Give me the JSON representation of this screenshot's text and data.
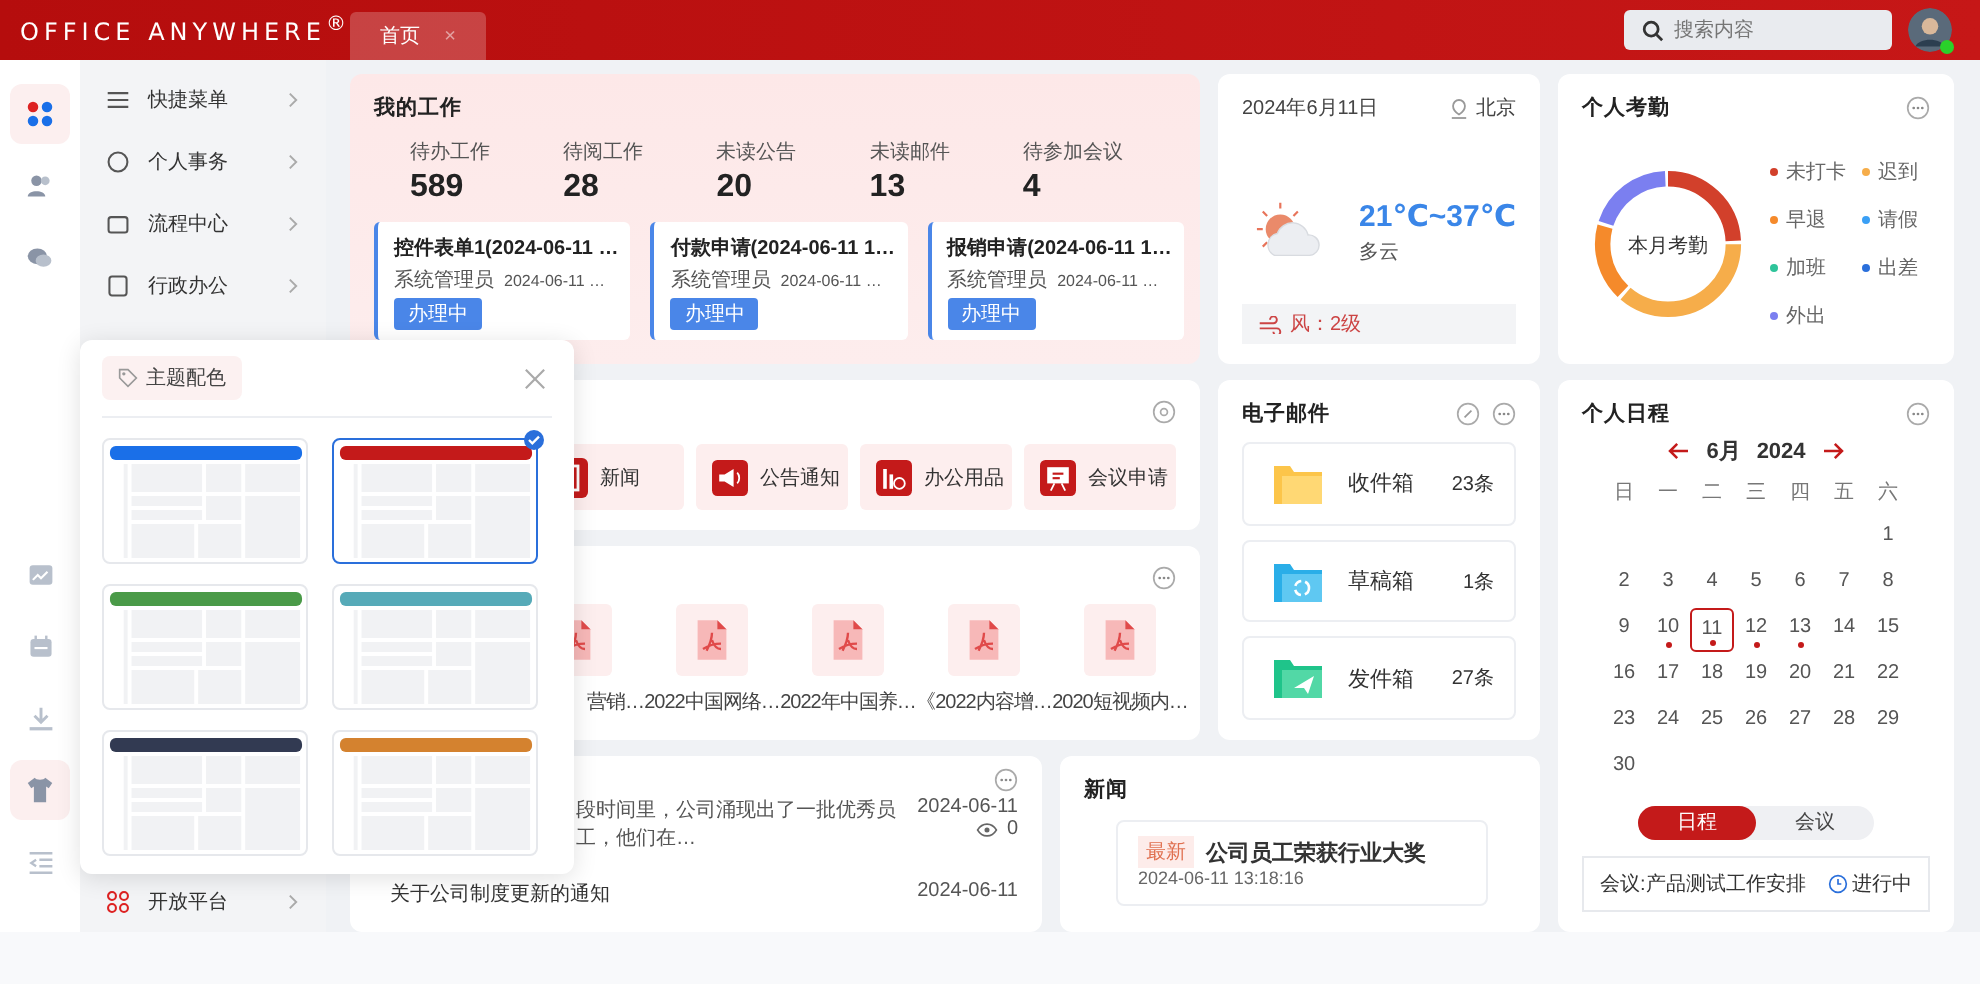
{
  "topbar": {
    "logo": "OFFICE ANYWHERE$^{®}$",
    "tabs": [
      {
        "label": "首页",
        "selected": true,
        "close": "×"
      }
    ],
    "search": {
      "placeholder": "搜索内容"
    },
    "user": {
      "online": true
    }
  },
  "rail_top": [
    {
      "kind": "apps",
      "selected": true
    },
    {
      "kind": "contacts",
      "selected": false
    },
    {
      "kind": "chat",
      "selected": false
    }
  ],
  "rail_bottom": [
    {
      "kind": "chart",
      "selected": false
    },
    {
      "kind": "calendar",
      "selected": false
    },
    {
      "kind": "download",
      "selected": false
    },
    {
      "kind": "theme",
      "selected": true
    },
    {
      "kind": "collapse",
      "selected": false
    }
  ],
  "menu": [
    {
      "label": "快捷菜单",
      "kind": "shortcut"
    },
    {
      "label": "个人事务",
      "kind": "personal"
    },
    {
      "label": "流程中心",
      "kind": "workflow"
    },
    {
      "label": "行政办公",
      "kind": "admin"
    }
  ],
  "menu_bottom": [
    {
      "label": "开放平台",
      "kind": "platform"
    }
  ],
  "theme_popup": {
    "title": "主题配色",
    "themes": [
      {
        "color": "#1a6fe8",
        "selected": false
      },
      {
        "color": "#c41a1a",
        "selected": true
      },
      {
        "color": "#4a9a48",
        "selected": false
      },
      {
        "color": "#56aab8",
        "selected": false
      },
      {
        "color": "#323a52",
        "selected": false
      },
      {
        "color": "#d4822f",
        "selected": false
      }
    ]
  },
  "my_work": {
    "title": "我的工作",
    "stats": [
      {
        "label": "待办工作",
        "value": "589"
      },
      {
        "label": "待阅工作",
        "value": "28"
      },
      {
        "label": "未读公告",
        "value": "20"
      },
      {
        "label": "未读邮件",
        "value": "13"
      },
      {
        "label": "待参加会议",
        "value": "4"
      }
    ],
    "tasks": [
      {
        "title": "控件表单1(2024-06-11 …",
        "user": "系统管理员",
        "date": "2024-06-11 …",
        "status": "办理中"
      },
      {
        "title": "付款申请(2024-06-11 1…",
        "user": "系统管理员",
        "date": "2024-06-11 …",
        "status": "办理中"
      },
      {
        "title": "报销申请(2024-06-11 1…",
        "user": "系统管理员",
        "date": "2024-06-11 …",
        "status": "办理中"
      }
    ]
  },
  "weather": {
    "date": "2024年6月11日",
    "city": "北京",
    "temp": "21℃~37℃",
    "desc": "多云",
    "wind": "风：2级"
  },
  "attendance": {
    "title": "个人考勤",
    "center": "本月考勤",
    "legend": [
      {
        "label": "未打卡",
        "color": "#d2402b"
      },
      {
        "label": "迟到",
        "color": "#f6ad4a"
      },
      {
        "label": "早退",
        "color": "#f58a2b"
      },
      {
        "label": "请假",
        "color": "#3a9ff5"
      },
      {
        "label": "加班",
        "color": "#2ec49a"
      },
      {
        "label": "出差",
        "color": "#2a6fdb"
      },
      {
        "label": "外出",
        "color": "#7b7ff0"
      }
    ]
  },
  "apps": {
    "items": [
      {
        "label": "新闻",
        "kind": "news"
      },
      {
        "label": "公告通知",
        "kind": "notice"
      },
      {
        "label": "办公用品",
        "kind": "supplies"
      },
      {
        "label": "会议申请",
        "kind": "meeting"
      }
    ]
  },
  "docs": {
    "items": [
      {
        "label": "营销…",
        "kind": "partial"
      },
      {
        "label": "2022中国网络…",
        "kind": "full"
      },
      {
        "label": "2022年中国养…",
        "kind": "full"
      },
      {
        "label": "《2022内容增…",
        "kind": "full"
      },
      {
        "label": "2020短视频内…",
        "kind": "full"
      }
    ]
  },
  "email": {
    "title": "电子邮件",
    "boxes": [
      {
        "name": "收件箱",
        "count": "23条",
        "kind": "inbox"
      },
      {
        "name": "草稿箱",
        "count": "1条",
        "kind": "draft"
      },
      {
        "name": "发件箱",
        "count": "27条",
        "kind": "sent"
      }
    ]
  },
  "schedule": {
    "title": "个人日程",
    "month": "6月",
    "year": "2024",
    "weekdays": [
      "日",
      "一",
      "二",
      "三",
      "四",
      "五",
      "六"
    ],
    "days": [
      {
        "day": "1",
        "event": false,
        "selected": false
      },
      {
        "day": "2",
        "event": false,
        "selected": false
      },
      {
        "day": "3",
        "event": false,
        "selected": false
      },
      {
        "day": "4",
        "event": false,
        "selected": false
      },
      {
        "day": "5",
        "event": false,
        "selected": false
      },
      {
        "day": "6",
        "event": false,
        "selected": false
      },
      {
        "day": "7",
        "event": false,
        "selected": false
      },
      {
        "day": "8",
        "event": false,
        "selected": false
      },
      {
        "day": "9",
        "event": false,
        "selected": false
      },
      {
        "day": "10",
        "event": true,
        "selected": false
      },
      {
        "day": "11",
        "event": true,
        "selected": true
      },
      {
        "day": "12",
        "event": true,
        "selected": false
      },
      {
        "day": "13",
        "event": true,
        "selected": false
      },
      {
        "day": "14",
        "event": false,
        "selected": false
      },
      {
        "day": "15",
        "event": false,
        "selected": false
      },
      {
        "day": "16",
        "event": false,
        "selected": false
      },
      {
        "day": "17",
        "event": false,
        "selected": false
      },
      {
        "day": "18",
        "event": false,
        "selected": false
      },
      {
        "day": "19",
        "event": false,
        "selected": false
      },
      {
        "day": "20",
        "event": false,
        "selected": false
      },
      {
        "day": "21",
        "event": false,
        "selected": false
      },
      {
        "day": "22",
        "event": false,
        "selected": false
      },
      {
        "day": "23",
        "event": false,
        "selected": false
      },
      {
        "day": "24",
        "event": false,
        "selected": false
      },
      {
        "day": "25",
        "event": false,
        "selected": false
      },
      {
        "day": "26",
        "event": false,
        "selected": false
      },
      {
        "day": "27",
        "event": false,
        "selected": false
      },
      {
        "day": "28",
        "event": false,
        "selected": false
      },
      {
        "day": "29",
        "event": false,
        "selected": false
      },
      {
        "day": "30",
        "event": false,
        "selected": false
      }
    ],
    "tabs": [
      {
        "label": "日程",
        "selected": true
      },
      {
        "label": "会议",
        "selected": false
      }
    ],
    "event": {
      "title": "会议:产品测试工作安排",
      "status": "进行中"
    }
  },
  "notices": {
    "items": [
      {
        "kind": "partial",
        "summary": "段时间里，公司涌现出了一批优秀员工，他们在…",
        "date": "2024-06-11",
        "views": "0"
      },
      {
        "kind": "full",
        "title": "关于公司制度更新的通知",
        "date": "2024-06-11"
      }
    ]
  },
  "news": {
    "title": "新闻",
    "item": {
      "tag": "最新",
      "title": "公司员工荣获行业大奖",
      "date": "2024-06-11 13:18:16"
    }
  }
}
